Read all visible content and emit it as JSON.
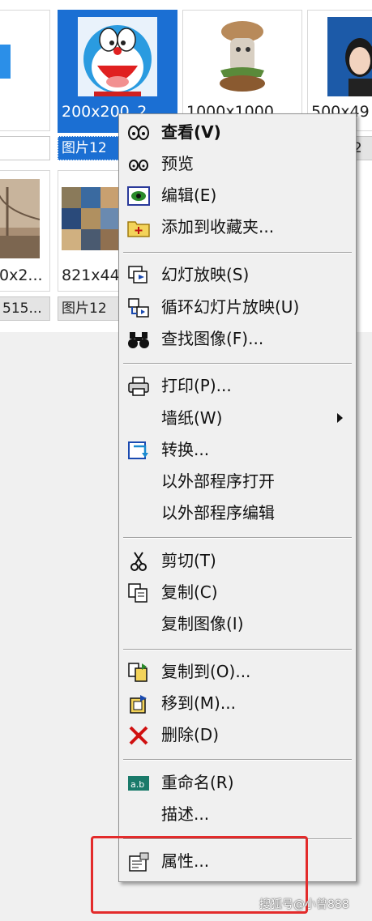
{
  "thumbnails": {
    "row1": [
      {
        "caption": "",
        "label": ""
      },
      {
        "caption": "200x200_2",
        "label": "图片12"
      },
      {
        "caption": "1000x1000",
        "label": ""
      },
      {
        "caption": "500x49",
        "label": "12"
      }
    ],
    "row2": [
      {
        "caption": "0x2...",
        "label": "515..."
      },
      {
        "caption": "821x44",
        "label": "图片12"
      }
    ]
  },
  "menu": {
    "view": "查看(V)",
    "preview": "预览",
    "edit": "编辑(E)",
    "add_fav": "添加到收藏夹...",
    "slideshow": "幻灯放映(S)",
    "loop_slideshow": "循环幻灯片放映(U)",
    "find_image": "查找图像(F)...",
    "print": "打印(P)...",
    "wallpaper": "墙纸(W)",
    "convert": "转换...",
    "open_external": "以外部程序打开",
    "edit_external": "以外部程序编辑",
    "cut": "剪切(T)",
    "copy": "复制(C)",
    "copy_image": "复制图像(I)",
    "copy_to": "复制到(O)...",
    "move_to": "移到(M)...",
    "delete": "删除(D)",
    "rename": "重命名(R)",
    "describe": "描述...",
    "properties": "属性..."
  },
  "watermark": "搜狐号@小曾888",
  "colors": {
    "selection": "#1b6fd3",
    "highlight_box": "#e32b2b"
  }
}
